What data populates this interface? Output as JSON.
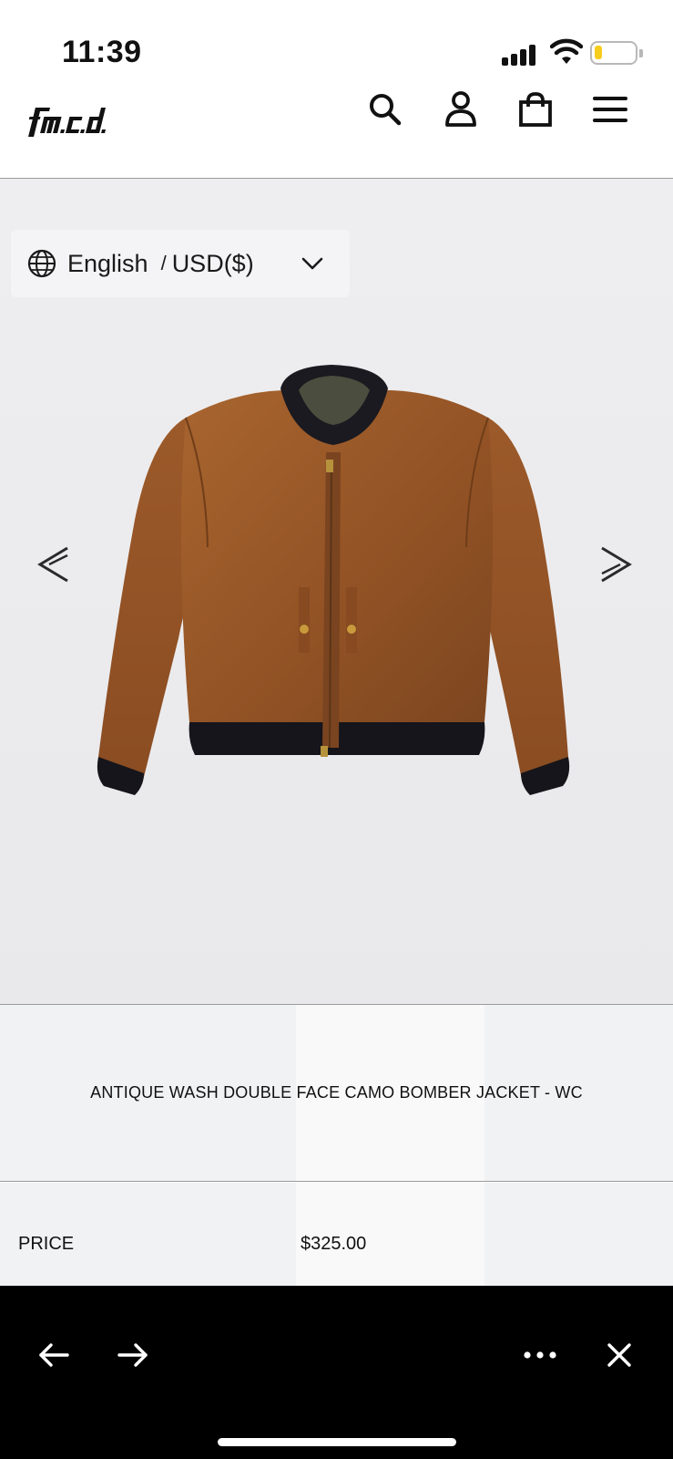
{
  "status_bar": {
    "time": "11:39",
    "icons": [
      "signal-icon",
      "wifi-icon",
      "battery-icon"
    ]
  },
  "header": {
    "logo_text": "f.m.c.d.",
    "icons": [
      "search-icon",
      "account-icon",
      "cart-icon",
      "menu-icon"
    ]
  },
  "locale": {
    "language": "English",
    "separator": "/",
    "currency": "USD($)"
  },
  "gallery": {
    "prev_icon": "chevron-double-left-icon",
    "next_icon": "chevron-double-right-icon"
  },
  "product": {
    "title": "ANTIQUE WASH DOUBLE FACE CAMO BOMBER JACKET - WC",
    "price_label": "PRICE",
    "price": "$325.00"
  },
  "browser_bar": {
    "icons": [
      "back-arrow-icon",
      "forward-arrow-icon",
      "more-icon",
      "close-icon"
    ]
  },
  "colors": {
    "jacket": "#9b5a2a",
    "battery": "#f6cd1c",
    "background": "#ededf0"
  }
}
